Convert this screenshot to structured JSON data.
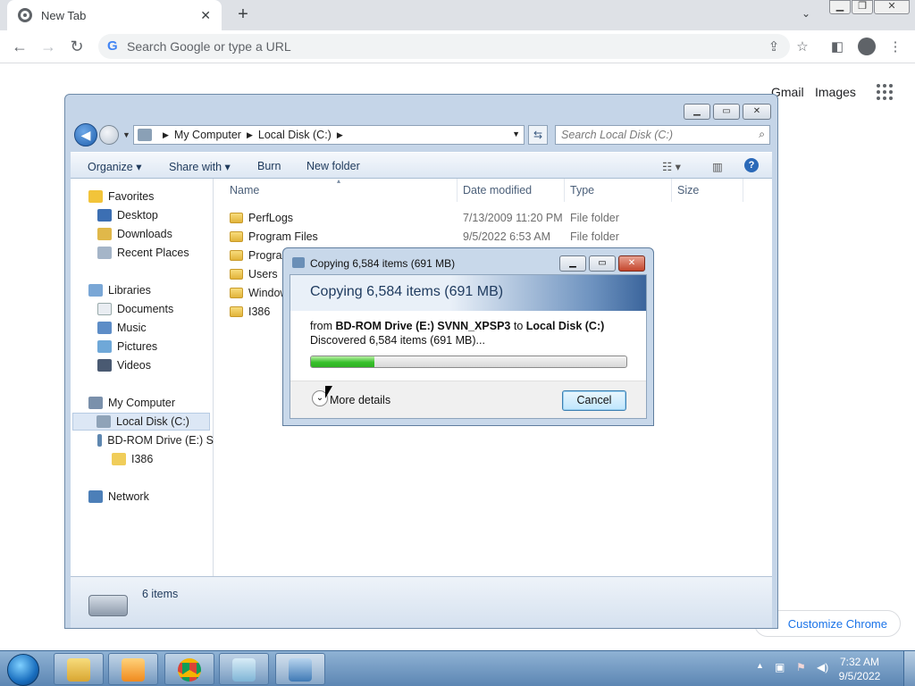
{
  "browser": {
    "tab_title": "New Tab",
    "omnibox_placeholder": "Search Google or type a URL",
    "links": {
      "gmail": "Gmail",
      "images": "Images"
    },
    "customize_label": "Customize Chrome"
  },
  "explorer": {
    "breadcrumb": [
      "My Computer",
      "Local Disk (C:)"
    ],
    "search_placeholder": "Search Local Disk (C:)",
    "commands": [
      "Organize",
      "Share with",
      "Burn",
      "New folder"
    ],
    "nav": {
      "favorites": "Favorites",
      "favorites_items": [
        "Desktop",
        "Downloads",
        "Recent Places"
      ],
      "libraries": "Libraries",
      "libraries_items": [
        "Documents",
        "Music",
        "Pictures",
        "Videos"
      ],
      "computer": "My Computer",
      "computer_items": [
        "Local Disk (C:)",
        "BD-ROM Drive (E:) S",
        "I386"
      ],
      "network": "Network"
    },
    "columns": [
      "Name",
      "Date modified",
      "Type",
      "Size"
    ],
    "files": [
      {
        "name": "PerfLogs",
        "date": "7/13/2009 11:20 PM",
        "type": "File folder"
      },
      {
        "name": "Program Files",
        "date": "9/5/2022 6:53 AM",
        "type": "File folder"
      },
      {
        "name": "Program",
        "date": "",
        "type": ""
      },
      {
        "name": "Users",
        "date": "",
        "type": ""
      },
      {
        "name": "Window",
        "date": "",
        "type": ""
      },
      {
        "name": "I386",
        "date": "",
        "type": ""
      }
    ],
    "status": "6 items"
  },
  "copy_dialog": {
    "title": "Copying 6,584 items (691 MB)",
    "header": "Copying 6,584 items (691 MB)",
    "from_prefix": "from",
    "source": "BD-ROM Drive (E:) SVNN_XPSP3",
    "to_word": "to",
    "destination": "Local Disk (C:)",
    "discovered": "Discovered 6,584 items (691 MB)...",
    "progress_fraction": 0.2,
    "more_details": "More details",
    "cancel": "Cancel"
  },
  "taskbar": {
    "time": "7:32 AM",
    "date": "9/5/2022"
  }
}
